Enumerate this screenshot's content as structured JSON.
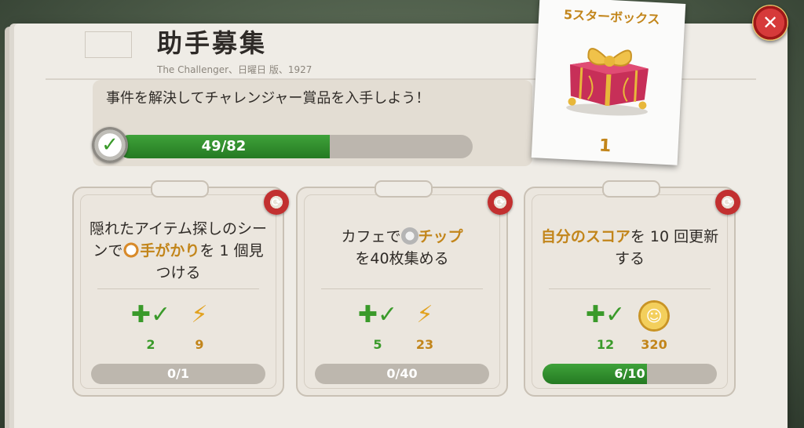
{
  "header": {
    "title": "助手募集",
    "dateline": "The Challenger、日曜日 版、1927"
  },
  "progress": {
    "text": "事件を解決してチャレンジャー賞品を入手しよう！",
    "current": 49,
    "total": 82,
    "label": "49/82"
  },
  "reward_card": {
    "title": "5スターボックス",
    "count": "1"
  },
  "tasks": [
    {
      "desc_parts": [
        "隠れたアイテム探しのシーンで",
        "手がかり",
        "を 1 個見つける"
      ],
      "reward_check": "2",
      "reward_second": "9",
      "reward_second_type": "bolt",
      "progress_label": "0/1",
      "progress_fraction": 0
    },
    {
      "desc_parts": [
        "カフェで",
        "チップ",
        "を40枚集める"
      ],
      "reward_check": "5",
      "reward_second": "23",
      "reward_second_type": "bolt",
      "progress_label": "0/40",
      "progress_fraction": 0
    },
    {
      "desc_parts": [
        "",
        "自分のスコア",
        "を 10 回更新する"
      ],
      "reward_check": "12",
      "reward_second": "320",
      "reward_second_type": "coin",
      "progress_label": "6/10",
      "progress_fraction": 0.6
    }
  ],
  "colors": {
    "accent_gold": "#c2851a",
    "progress_green": "#3fa23a",
    "close_red": "#d63a3a"
  },
  "icons": {
    "close": "close-icon",
    "refresh": "refresh-icon",
    "check": "check-plus-icon",
    "bolt": "lightning-bolt-icon",
    "coin": "gold-coin-icon"
  }
}
